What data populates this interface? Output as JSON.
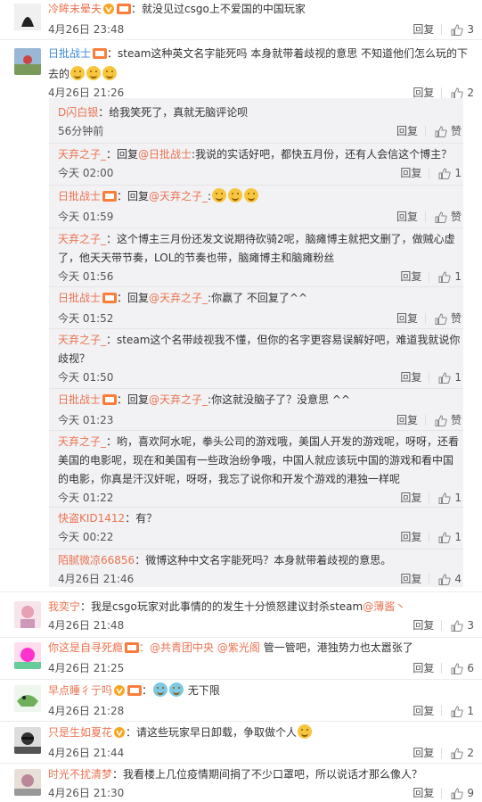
{
  "c0": {
    "name": "冷眸末晕夫",
    "text": "：就没见过csgo上不爱国的中国玩家",
    "time": "4月26日 23:48",
    "reply": "回复",
    "likes": "3"
  },
  "c1": {
    "name": "日批战士",
    "text": "：steam这种英文名字能死吗 本身就带着歧视的意思 不知道他们怎么玩的下去的",
    "time": "4月26日 21:26",
    "reply": "回复",
    "likes": "2"
  },
  "subs": [
    {
      "name": "D闪白银",
      "text": "：给我笑死了，真就无脑评论呗",
      "time": "56分钟前",
      "reply": "回复",
      "likes": "赞"
    },
    {
      "name": "天弃之子_",
      "pre": "：回复",
      "at": "@日批战士",
      "text": ":我说的实话好吧，都快五月份，还有人会信这个博主？",
      "time": "今天 02:00",
      "reply": "回复",
      "likes": "1"
    },
    {
      "name": "日批战士",
      "pre": "：回复",
      "at": "@天弃之子_",
      "text": ":",
      "time": "今天 01:59",
      "reply": "回复",
      "likes": "赞"
    },
    {
      "name": "天弃之子_",
      "text": "：这个博主三月份还发文说期待砍骑2呢，脑瘫博主就把文删了，做贼心虚了，他天天带节奏，LOL的节奏也带，脑瘫博主和脑瘫粉丝",
      "time": "今天 01:56",
      "reply": "回复",
      "likes": "1"
    },
    {
      "name": "日批战士",
      "pre": "：回复",
      "at": "@天弃之子_",
      "text": ":你赢了 不回复了^^",
      "time": "今天 01:52",
      "reply": "回复",
      "likes": "赞"
    },
    {
      "name": "天弃之子_",
      "text": "：steam这个名带歧视我不懂，但你的名字更容易误解好吧，难道我就说你歧视？",
      "time": "今天 01:50",
      "reply": "回复",
      "likes": "1"
    },
    {
      "name": "日批战士",
      "pre": "：回复",
      "at": "@天弃之子_",
      "text": ":你这就没脑子了？没意思 ^^",
      "time": "今天 01:23",
      "reply": "回复",
      "likes": "赞"
    },
    {
      "name": "天弃之子_",
      "text": "：哟，喜欢阿水呢，拳头公司的游戏哦，美国人开发的游戏呢，呀呀，还看美国的电影呢，现在和美国有一些政治纷争哦，中国人就应该玩中国的游戏和看中国的电影，你真是汗汉奸呢，呀呀，我忘了说你和开发个游戏的港独一样呢",
      "time": "今天 01:22",
      "reply": "回复",
      "likes": "1"
    },
    {
      "name": "快盗KID1412",
      "text": "：有？",
      "time": "今天 00:22",
      "reply": "回复",
      "likes": "1"
    },
    {
      "name": "陌腻微凉66856",
      "text": "：微博这种中文名字能死吗？本身就带着歧视的意思。",
      "time": "4月26日 21:46",
      "reply": "回复",
      "likes": "4"
    }
  ],
  "c2": {
    "name": "我奕宁",
    "text": "：我是csgo玩家对此事情的的发生十分愤怒建议封杀steam",
    "at": "@薄酱丶",
    "time": "4月26日 21:48",
    "reply": "回复",
    "likes": "3"
  },
  "c3": {
    "name": "你这是自寻死瘾",
    "at1": "：@共青团中央",
    "at2": "@紫光阁",
    "text": "管一管吧，港独势力也太嚣张了",
    "time": "4月26日 21:25",
    "reply": "回复",
    "likes": "6"
  },
  "c4": {
    "name": "早点睡彳亍吗",
    "text": "：",
    "text2": "无下限",
    "time": "4月26日 21:28",
    "reply": "回复",
    "likes": "1"
  },
  "c5": {
    "name": "只是生如夏花",
    "text": "：请这些玩家早日卸载，争取做个人",
    "time": "4月26日 21:44",
    "reply": "回复",
    "likes": "2"
  },
  "c6": {
    "name": "时光不扰清梦",
    "text": "：我看楼上几位疫情期间捐了不少口罩吧，所以说话才那么像人？",
    "time": "4月26日 21:30",
    "reply": "回复",
    "likes": "9"
  }
}
